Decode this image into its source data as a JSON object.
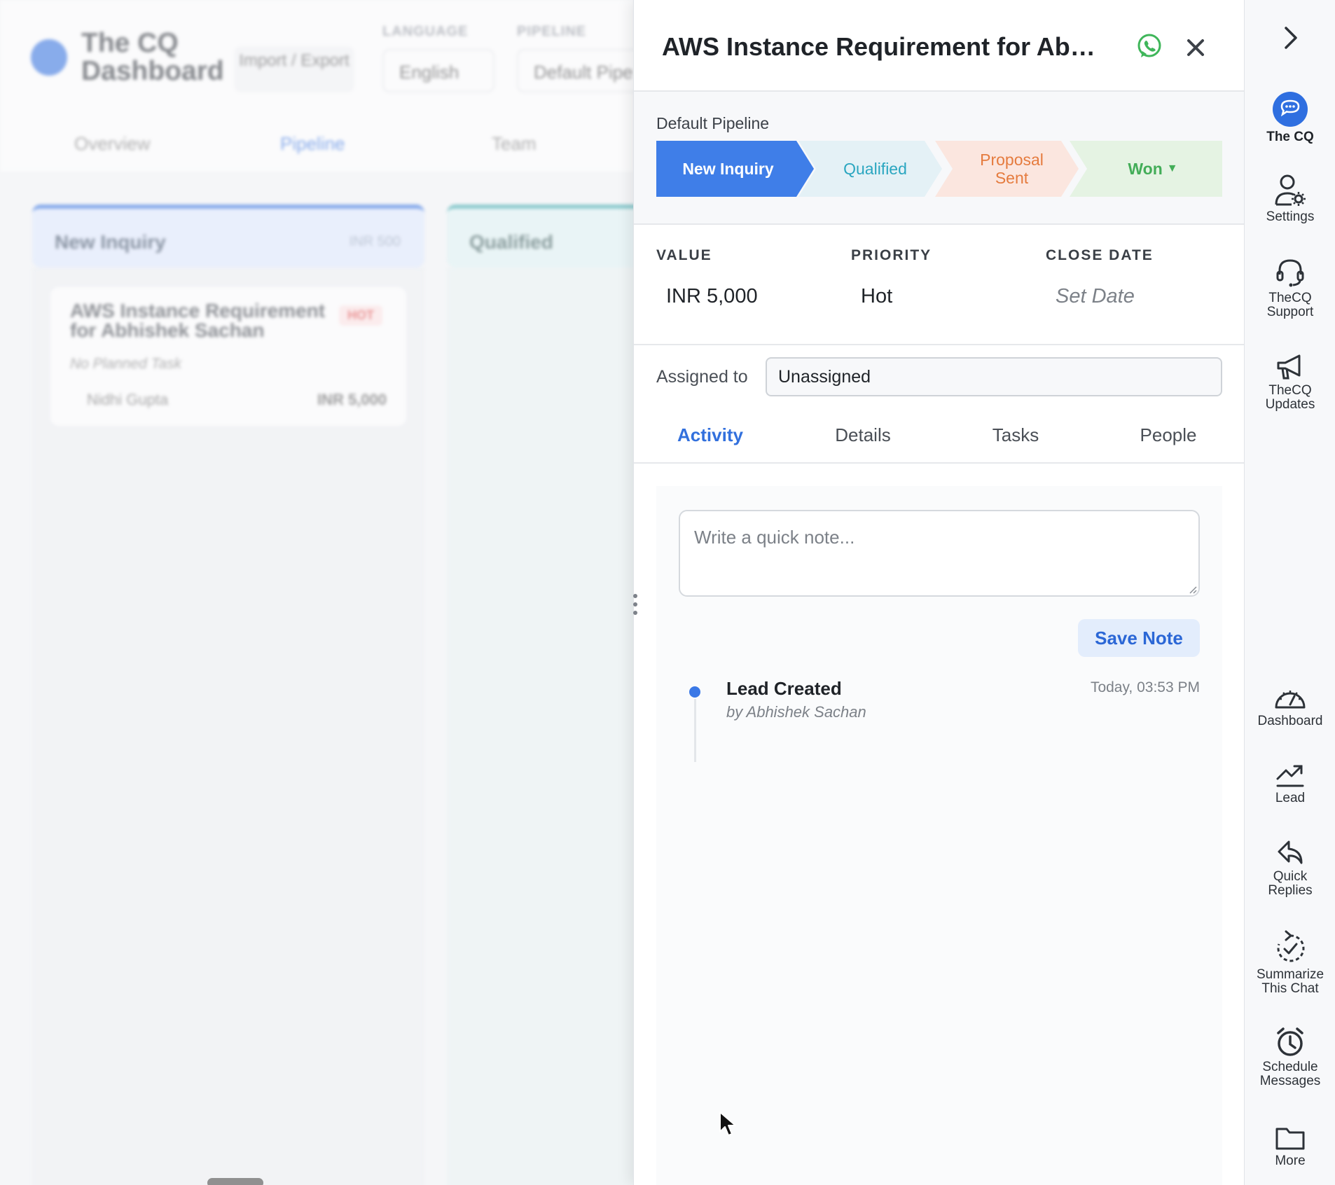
{
  "background": {
    "app_title": "The CQ Dashboard",
    "import_export_label": "Import / Export",
    "language_label": "LANGUAGE",
    "language_value": "English",
    "pipeline_label": "PIPELINE",
    "pipeline_value": "Default Pipe",
    "tabs": [
      "Overview",
      "Pipeline",
      "Team"
    ],
    "columns": [
      {
        "name": "New Inquiry",
        "amount": "INR 500"
      },
      {
        "name": "Qualified"
      }
    ],
    "card": {
      "title": "AWS Instance Requirement for Abhishek Sachan",
      "badge": "HOT",
      "task": "No Planned Task",
      "owner": "Nidhi Gupta",
      "amount": "INR 5,000"
    }
  },
  "drawer": {
    "title": "AWS Instance Requirement for Abhi...",
    "pipeline_label": "Default Pipeline",
    "stages": [
      {
        "label": "New Inquiry"
      },
      {
        "label": "Qualified"
      },
      {
        "label": "Proposal Sent"
      },
      {
        "label": "Won"
      }
    ],
    "stage_caret": "▼",
    "meta": {
      "value_label": "VALUE",
      "value": "INR 5,000",
      "priority_label": "PRIORITY",
      "priority": "Hot",
      "close_date_label": "CLOSE DATE",
      "close_date": "Set Date"
    },
    "assigned_label": "Assigned to",
    "assigned_value": "Unassigned",
    "tabs": [
      "Activity",
      "Details",
      "Tasks",
      "People"
    ],
    "note_placeholder": "Write a quick note...",
    "save_note_label": "Save Note",
    "timeline": [
      {
        "title": "Lead Created",
        "by": "by Abhishek Sachan",
        "time": "Today, 03:53 PM"
      }
    ]
  },
  "sidebar": {
    "items": [
      {
        "label": "The CQ"
      },
      {
        "label": "Settings"
      },
      {
        "label": "TheCQ Support"
      },
      {
        "label": "TheCQ Updates"
      },
      {
        "label": "Dashboard"
      },
      {
        "label": "Lead"
      },
      {
        "label": "Quick Replies"
      },
      {
        "label": "Summarize This Chat"
      },
      {
        "label": "Schedule Messages"
      },
      {
        "label": "More"
      }
    ]
  },
  "colors": {
    "accent": "#3f7ee8",
    "whatsapp": "#3fb65a",
    "qualified": "#2aa6c0",
    "proposal": "#e57b3e",
    "won": "#43ad58"
  }
}
